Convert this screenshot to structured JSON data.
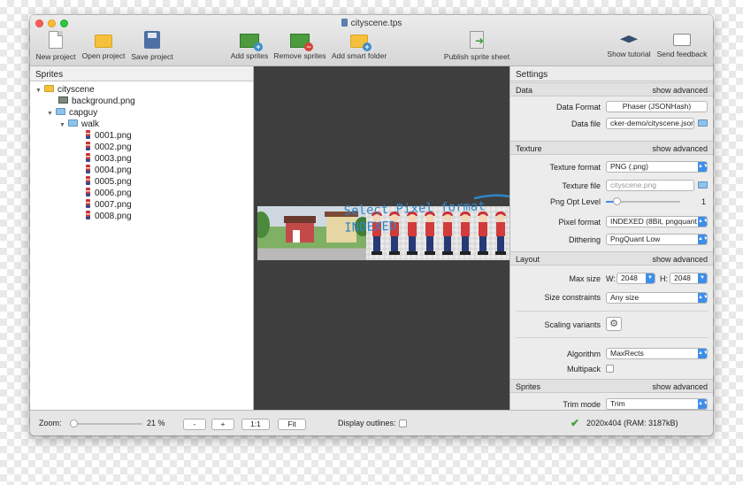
{
  "window": {
    "title": "cityscene.tps"
  },
  "toolbar": {
    "new_project": "New project",
    "open_project": "Open project",
    "save_project": "Save project",
    "add_sprites": "Add sprites",
    "remove_sprites": "Remove sprites",
    "add_smart_folder": "Add smart folder",
    "publish_sprite_sheet": "Publish sprite sheet",
    "show_tutorial": "Show tutorial",
    "send_feedback": "Send feedback"
  },
  "sprites_panel": {
    "title": "Sprites",
    "tree": {
      "root": "cityscene",
      "background": "background.png",
      "capguy": "capguy",
      "walk": "walk",
      "frames": [
        "0001.png",
        "0002.png",
        "0003.png",
        "0004.png",
        "0005.png",
        "0006.png",
        "0007.png",
        "0008.png"
      ]
    }
  },
  "annotation": {
    "line1": "Select Pixel format",
    "line2": "INDEXED"
  },
  "settings": {
    "title": "Settings",
    "show_advanced": "show advanced",
    "data": {
      "header": "Data",
      "data_format_label": "Data Format",
      "data_format_value": "Phaser (JSONHash)",
      "data_file_label": "Data file",
      "data_file_value": "cker-demo/cityscene.json"
    },
    "texture": {
      "header": "Texture",
      "texture_format_label": "Texture format",
      "texture_format_value": "PNG (.png)",
      "texture_file_label": "Texture file",
      "texture_file_value": "cityscene.png",
      "png_opt_label": "Png Opt Level",
      "png_opt_value": "1",
      "png_opt_fraction": 0.14,
      "pixel_format_label": "Pixel format",
      "pixel_format_value": "INDEXED (8Bit, pngquant",
      "dithering_label": "Dithering",
      "dithering_value": "PngQuant Low"
    },
    "layout": {
      "header": "Layout",
      "max_size_label": "Max size",
      "w_label": "W:",
      "w_value": "2048",
      "h_label": "H:",
      "h_value": "2048",
      "size_constraints_label": "Size constraints",
      "size_constraints_value": "Any size",
      "scaling_variants_label": "Scaling variants",
      "algorithm_label": "Algorithm",
      "algorithm_value": "MaxRects",
      "multipack_label": "Multipack"
    },
    "sprites": {
      "header": "Sprites",
      "trim_mode_label": "Trim mode",
      "trim_mode_value": "Trim"
    }
  },
  "statusbar": {
    "zoom_label": "Zoom:",
    "zoom_value": "21 %",
    "zoom_fraction": 0.05,
    "zoom_out": "-",
    "zoom_in": "+",
    "zoom_1to1": "1:1",
    "zoom_fit": "Fit",
    "display_outlines": "Display outlines:",
    "sheet_info": "2020x404 (RAM: 3187kB)"
  },
  "colors": {
    "accent": "#3c8ee9",
    "annotation": "#2f86c7",
    "success": "#3aa341"
  }
}
